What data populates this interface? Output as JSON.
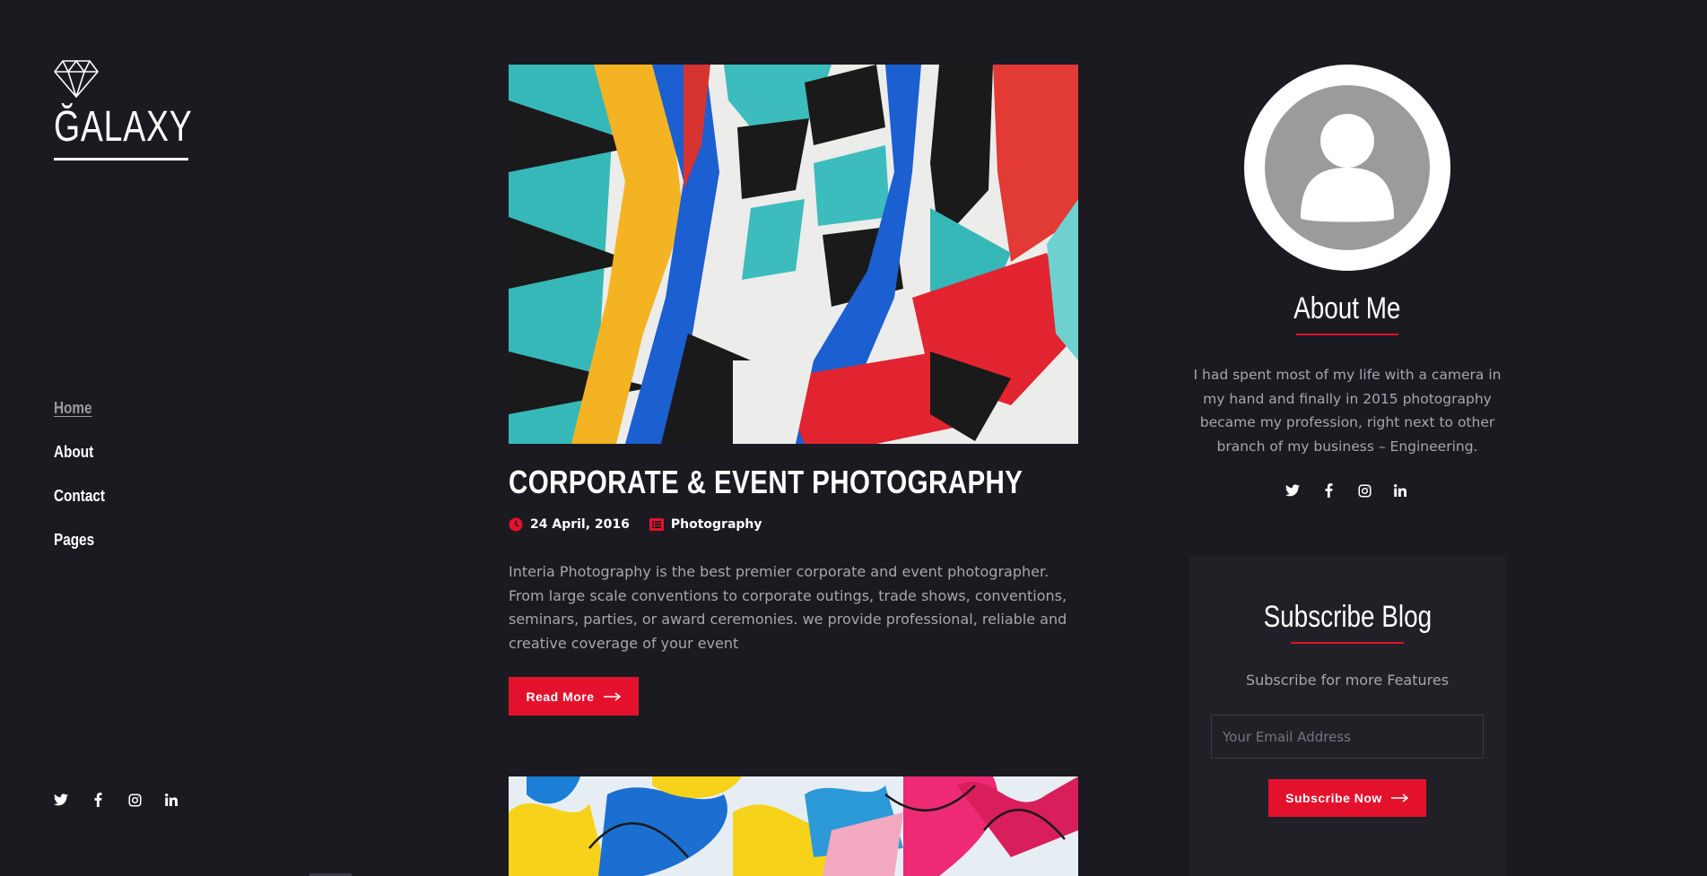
{
  "brand": {
    "logo_text": "ĞALAXY",
    "accent": "#e4112c",
    "background": "#1b1a20"
  },
  "nav": {
    "items": [
      {
        "label": "Home",
        "active": true
      },
      {
        "label": "About",
        "active": false
      },
      {
        "label": "Contact",
        "active": false
      },
      {
        "label": "Pages",
        "active": false
      }
    ]
  },
  "social_icons": [
    "twitter-icon",
    "facebook-icon",
    "instagram-icon",
    "linkedin-icon"
  ],
  "post": {
    "title": "CORPORATE & EVENT PHOTOGRAPHY",
    "date": "24 April, 2016",
    "category": "Photography",
    "excerpt": "Interia Photography is the best premier corporate and event photographer. From large scale conventions to corporate outings, trade shows, conventions, seminars, parties, or award ceremonies. we provide professional, reliable and creative coverage of your event",
    "read_more_label": "Read More"
  },
  "about": {
    "title": "About Me",
    "text": "I had spent most of my life with a camera in my hand and finally in 2015 photography became my profession, right next to other branch of my business – Engineering."
  },
  "subscribe": {
    "title": "Subscribe Blog",
    "subtitle": "Subscribe for more Features",
    "email_placeholder": "Your Email Address",
    "button_label": "Subscribe Now"
  }
}
